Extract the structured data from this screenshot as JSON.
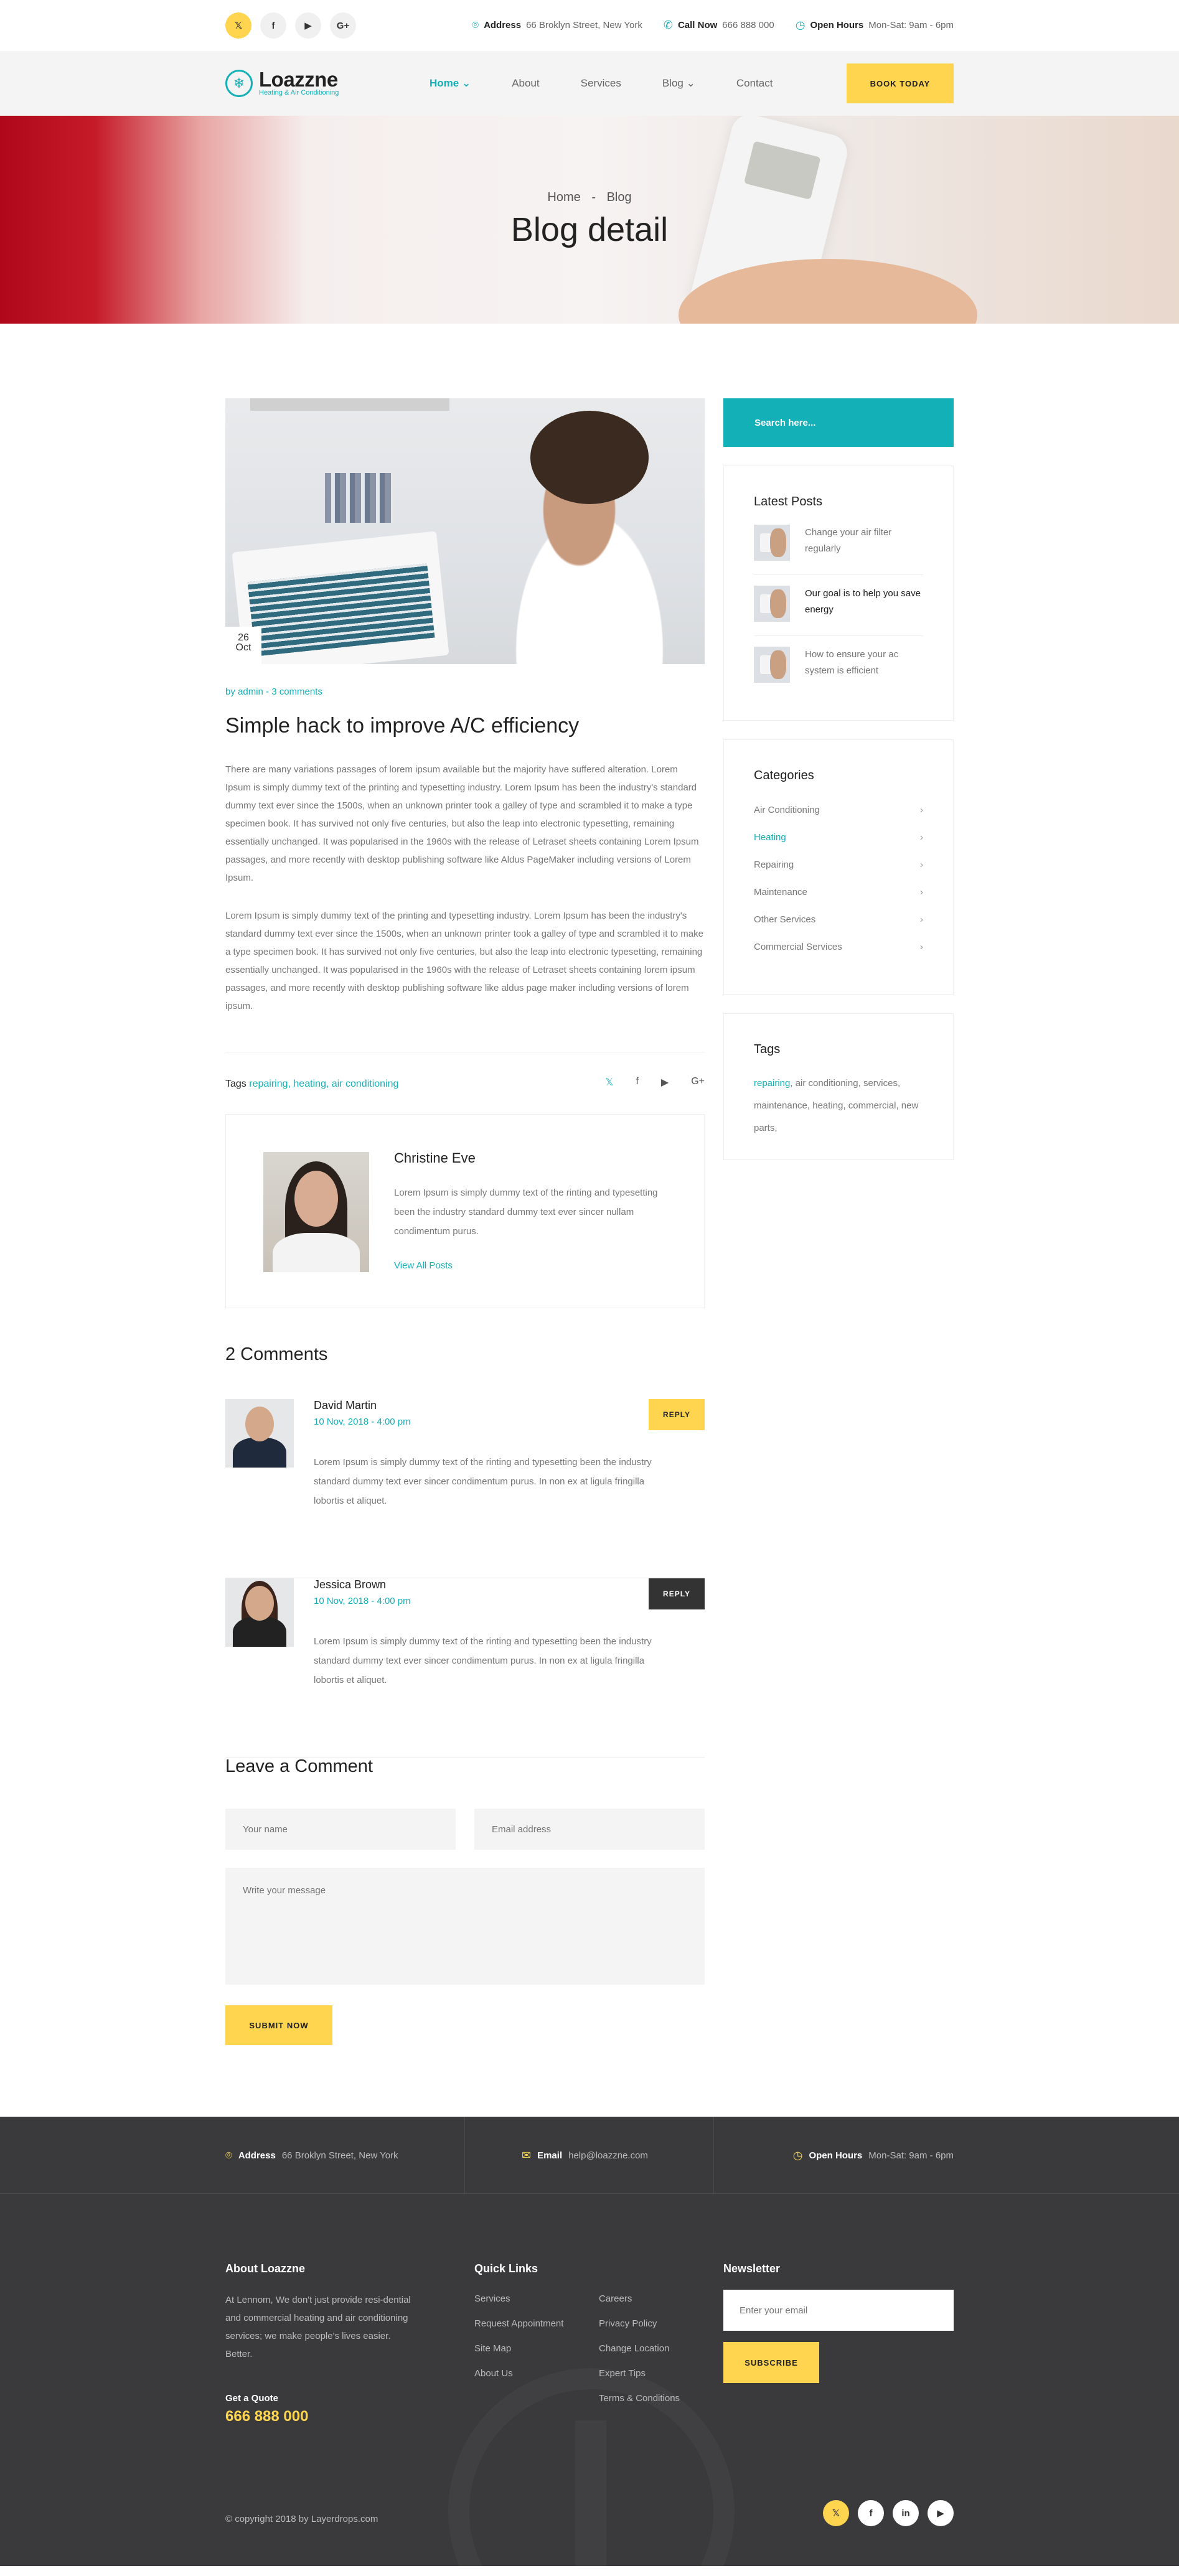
{
  "topbar": {
    "social": [
      {
        "icon": "twitter-icon",
        "glyph": "𝕏"
      },
      {
        "icon": "facebook-icon",
        "glyph": "f"
      },
      {
        "icon": "youtube-icon",
        "glyph": "▶"
      },
      {
        "icon": "google-plus-icon",
        "glyph": "G+"
      }
    ],
    "address_label": "Address",
    "address": "66 Broklyn Street, New York",
    "call_label": "Call Now",
    "call": "666 888 000",
    "hours_label": "Open Hours",
    "hours": "Mon-Sat: 9am - 6pm"
  },
  "nav": {
    "logo_name": "Loazzne",
    "logo_sub": "Heating & Air Conditioning",
    "items": [
      "Home",
      "About",
      "Services",
      "Blog",
      "Contact"
    ],
    "book_label": "BOOK TODAY"
  },
  "hero": {
    "crumb_home": "Home",
    "crumb_sep": "-",
    "crumb_current": "Blog",
    "title": "Blog detail"
  },
  "post": {
    "day": "26",
    "month": "Oct",
    "meta": "by admin  -  3 comments",
    "title": "Simple hack to improve A/C efficiency",
    "p1": "There are many variations passages of lorem ipsum available but the majority have suffered alteration. Lorem Ipsum is simply dummy text of the printing and typesetting industry. Lorem Ipsum has been the industry's standard dummy text ever since the 1500s, when an unknown printer took a galley of type and scrambled it to make a type specimen book. It has survived not only five centuries, but also the leap into electronic typesetting, remaining essentially unchanged. It was popularised in the 1960s with the release of Letraset sheets containing Lorem Ipsum passages, and more recently with desktop publishing software like Aldus PageMaker including versions of Lorem Ipsum.",
    "p2": "Lorem Ipsum is simply dummy text of the printing and typesetting industry. Lorem Ipsum has been the industry's standard dummy text ever since the 1500s, when an unknown printer took a galley of type and scrambled it to make a type specimen book. It has survived not only five centuries, but also the leap into electronic typesetting, remaining essentially unchanged. It was popularised in the 1960s with the release of Letraset sheets containing lorem ipsum passages, and more recently with desktop publishing software like aldus page maker including versions of lorem ipsum.",
    "tags_label": "Tags",
    "tags": "repairing, heating, air conditioning",
    "share": [
      {
        "icon": "twitter-icon",
        "glyph": "𝕏"
      },
      {
        "icon": "facebook-icon",
        "glyph": "f"
      },
      {
        "icon": "youtube-icon",
        "glyph": "▶"
      },
      {
        "icon": "google-plus-icon",
        "glyph": "G+"
      }
    ]
  },
  "author": {
    "name": "Christine Eve",
    "bio": "Lorem Ipsum is simply dummy text of the rinting and typesetting been the industry standard dummy text ever sincer nullam condimentum purus.",
    "view_all": "View All Posts"
  },
  "comments": {
    "title": "2 Comments",
    "items": [
      {
        "name": "David Martin",
        "date": "10 Nov, 2018   -   4:00 pm",
        "text": "Lorem Ipsum is simply dummy text of the rinting and typesetting been the industry standard dummy text ever sincer condimentum purus. In non ex at ligula fringilla lobortis et aliquet.",
        "reply": "REPLY"
      },
      {
        "name": "Jessica Brown",
        "date": "10 Nov, 2018   -   4:00 pm",
        "text": "Lorem Ipsum is simply dummy text of the rinting and typesetting been the industry standard dummy text ever sincer condimentum purus. In non ex at ligula fringilla lobortis et aliquet.",
        "reply": "REPLY"
      }
    ]
  },
  "form": {
    "title": "Leave a Comment",
    "name_placeholder": "Your name",
    "email_placeholder": "Email address",
    "message_placeholder": "Write your message",
    "submit": "SUBMIT NOW"
  },
  "sidebar": {
    "search_placeholder": "Search here...",
    "latest_title": "Latest Posts",
    "latest": [
      "Change your air filter regularly",
      "Our goal is to help you save energy",
      "How to ensure your ac system is efficient"
    ],
    "categories_title": "Categories",
    "categories": [
      "Air Conditioning",
      "Heating",
      "Repairing",
      "Maintenance",
      "Other Services",
      "Commercial Services"
    ],
    "tags_title": "Tags",
    "tags_first": "repairing",
    "tags_rest": ", air conditioning, services, maintenance, heating, commercial, new parts,"
  },
  "footer": {
    "address_label": "Address",
    "address": "66 Broklyn Street, New York",
    "email_label": "Email",
    "email": "help@loazzne.com",
    "hours_label": "Open Hours",
    "hours": "Mon-Sat: 9am - 6pm",
    "about_title": "About Loazzne",
    "about_text": "At Lennom, We don't just provide resi-dential and commercial heating and air conditioning services; we make people's lives easier. Better.",
    "quote_label": "Get a Quote",
    "quote_number": "666 888 000",
    "links_title": "Quick Links",
    "links_col1": [
      "Services",
      "Request Appointment",
      "Site Map",
      "About Us"
    ],
    "links_col2": [
      "Careers",
      "Privacy Policy",
      "Change Location",
      "Expert Tips",
      "Terms & Conditions"
    ],
    "newsletter_title": "Newsletter",
    "newsletter_placeholder": "Enter your email",
    "subscribe": "SUBSCRIBE",
    "copyright": "© copyright 2018 by Layerdrops.com",
    "social": [
      {
        "icon": "twitter-icon",
        "glyph": "𝕏"
      },
      {
        "icon": "facebook-icon",
        "glyph": "f"
      },
      {
        "icon": "linkedin-icon",
        "glyph": "in"
      },
      {
        "icon": "youtube-icon",
        "glyph": "▶"
      }
    ]
  },
  "colors": {
    "accent": "#14b0b8",
    "yellow": "#ffd54f",
    "dark": "#3a3a3c"
  }
}
